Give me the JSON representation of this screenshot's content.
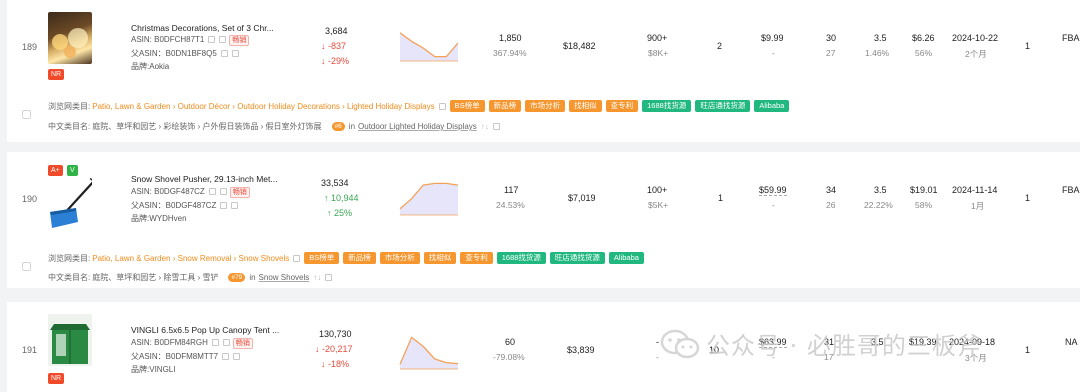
{
  "rows": [
    {
      "rank": "189",
      "badges": [
        "NR"
      ],
      "title": "Christmas Decorations, Set of 3 Chr...",
      "asin_label": "ASIN: ",
      "asin": "B0DFCH87T1",
      "parent_label": "父ASIN：",
      "parent_asin": "B0DN1BF8Q5",
      "brand_label": "品牌:",
      "brand": "Aokia",
      "hot_label": "畅销",
      "bsr": "3,684",
      "bsr_change": "↓ -837",
      "bsr_pct": "↓ -29%",
      "trend": "down",
      "sparkline": [
        0.8,
        0.55,
        0.35,
        0.1,
        0.1,
        0.5
      ],
      "sales": "1,850",
      "sales_pct": "367.94%",
      "revenue": "$18,482",
      "reviews": "900+",
      "reviews_sub": "$8K+",
      "variants": "2",
      "price": "$9.99",
      "price_sub": "-",
      "col_a": "30",
      "col_a_sub": "27",
      "rating": "3.5",
      "rating_sub": "1.46%",
      "fee": "$6.26",
      "fee_sub": "56%",
      "date": "2024-10-22",
      "date_sub": "2个月",
      "sellers": "1",
      "fulfill": "FBA",
      "cat_label": "浏览网类目:",
      "cat_path": "Patio, Lawn & Garden › Outdoor Décor › Outdoor Holiday Decorations › Lighted Holiday Displays",
      "cn_label": "中文类目名:",
      "cn_path": "庭院、草坪和园艺 › 彩绘装饰 › 户外假日装饰品 › 假日室外灯饰展",
      "rank_pill": "#6",
      "rank_in": "in",
      "rank_cat": "Outdoor Lighted Holiday Displays",
      "rank_arrows": "↑↓"
    },
    {
      "rank": "190",
      "badges": [
        "A+",
        "V"
      ],
      "title": "Snow Shovel Pusher, 29.13-inch Met...",
      "asin_label": "ASIN: ",
      "asin": "B0DGF487CZ",
      "parent_label": "父ASIN：",
      "parent_asin": "B0DGF487CZ",
      "brand_label": "品牌:",
      "brand": "WYDHven",
      "hot_label": "畅销",
      "bsr": "33,534",
      "bsr_change": "↑ 10,944",
      "bsr_pct": "↑ 25%",
      "trend": "up",
      "sparkline": [
        0.15,
        0.45,
        0.85,
        0.9,
        0.9,
        0.85
      ],
      "sales": "117",
      "sales_pct": "24.53%",
      "revenue": "$7,019",
      "reviews": "100+",
      "reviews_sub": "$5K+",
      "variants": "1",
      "price": "$59.99",
      "price_sub": "-",
      "col_a": "34",
      "col_a_sub": "26",
      "rating": "3.5",
      "rating_sub": "22.22%",
      "fee": "$19.01",
      "fee_sub": "58%",
      "date": "2024-11-14",
      "date_sub": "1月",
      "sellers": "1",
      "fulfill": "FBA",
      "cat_label": "浏览网类目:",
      "cat_path": "Patio, Lawn & Garden › Snow Removal › Snow Shovels",
      "cn_label": "中文类目名:",
      "cn_path": "庭院、草坪和园艺 › 除雪工具 › 雪铲",
      "rank_pill": "#79",
      "rank_in": "in",
      "rank_cat": "Snow Shovels",
      "rank_arrows": "↑↓"
    },
    {
      "rank": "191",
      "badges": [
        "NR"
      ],
      "title": "VINGLI 6.5x6.5 Pop Up Canopy Tent ...",
      "asin_label": "ASIN: ",
      "asin": "B0DFM84RGH",
      "parent_label": "父ASIN：",
      "parent_asin": "B0DFM8MTT7",
      "brand_label": "品牌:",
      "brand": "VINGLI",
      "hot_label": "畅销",
      "bsr": "130,730",
      "bsr_change": "↓ -20,217",
      "bsr_pct": "↓ -18%",
      "trend": "down",
      "sparkline": [
        0.1,
        0.85,
        0.6,
        0.25,
        0.15,
        0.12
      ],
      "sales": "60",
      "sales_pct": "-79.08%",
      "revenue": "$3,839",
      "reviews": "-",
      "reviews_sub": "-",
      "variants": "10",
      "price": "$63.99",
      "price_sub": "-",
      "col_a": "31",
      "col_a_sub": "17",
      "rating": "3.5",
      "rating_sub": "",
      "fee": "$19.39",
      "fee_sub": "",
      "date": "2024-09-18",
      "date_sub": "3个月",
      "sellers": "1",
      "fulfill": "NA"
    }
  ],
  "tags": [
    "BS榜单",
    "新品榜",
    "市场分析",
    "找相似",
    "查专利",
    "1688找货源",
    "旺店通找货源",
    "Alibaba"
  ],
  "colors": {
    "orange": "#f5962f",
    "green": "#21b880",
    "red": "#e64b3b",
    "up": "#3aa655",
    "spark": "#f3a25a",
    "spark_fill": "#c9c5f2"
  },
  "watermark": {
    "label": "公众号 · 必胜哥的三板斧"
  }
}
